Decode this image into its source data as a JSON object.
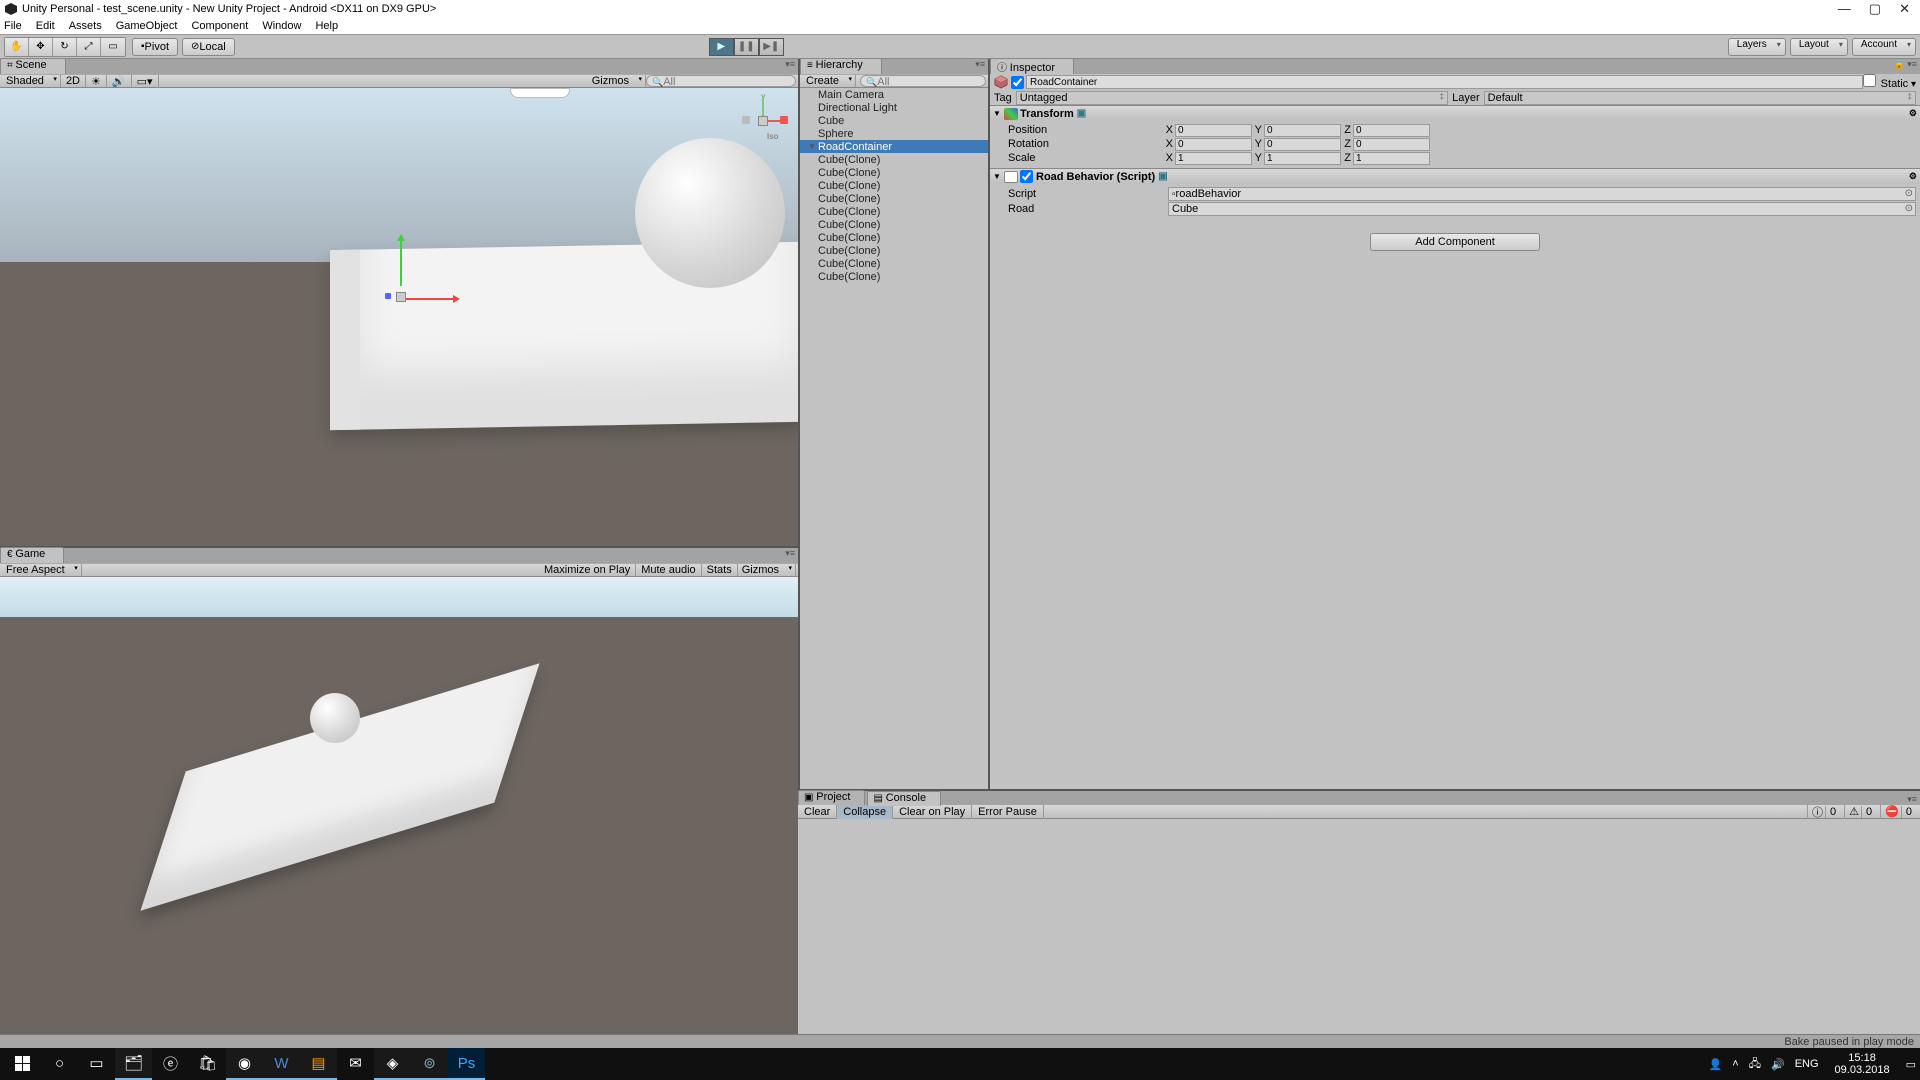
{
  "title": "Unity Personal - test_scene.unity - New Unity Project - Android <DX11 on DX9 GPU>",
  "menu": [
    "File",
    "Edit",
    "Assets",
    "GameObject",
    "Component",
    "Window",
    "Help"
  ],
  "toolbar": {
    "pivot": "Pivot",
    "local": "Local",
    "layers": "Layers",
    "layout": "Layout",
    "account": "Account"
  },
  "scene": {
    "tab": "Scene",
    "shading": "Shaded",
    "twoD": "2D",
    "gizmos": "Gizmos",
    "search_placeholder": "All",
    "orient_label": "Iso"
  },
  "game": {
    "tab": "Game",
    "aspect": "Free Aspect",
    "maxOnPlay": "Maximize on Play",
    "muteAudio": "Mute audio",
    "stats": "Stats",
    "gizmos": "Gizmos"
  },
  "hierarchy": {
    "tab": "Hierarchy",
    "create": "Create",
    "search_placeholder": "All",
    "items": [
      {
        "name": "Main Camera"
      },
      {
        "name": "Directional Light"
      },
      {
        "name": "Cube"
      },
      {
        "name": "Sphere"
      },
      {
        "name": "RoadContainer",
        "selected": true,
        "expandable": true
      },
      {
        "name": "Cube(Clone)",
        "indent": 1
      },
      {
        "name": "Cube(Clone)",
        "indent": 1
      },
      {
        "name": "Cube(Clone)",
        "indent": 1
      },
      {
        "name": "Cube(Clone)",
        "indent": 1
      },
      {
        "name": "Cube(Clone)",
        "indent": 1
      },
      {
        "name": "Cube(Clone)",
        "indent": 1
      },
      {
        "name": "Cube(Clone)",
        "indent": 1
      },
      {
        "name": "Cube(Clone)",
        "indent": 1
      },
      {
        "name": "Cube(Clone)",
        "indent": 1
      },
      {
        "name": "Cube(Clone)",
        "indent": 1
      }
    ]
  },
  "inspector": {
    "tab": "Inspector",
    "objectName": "RoadContainer",
    "staticLabel": "Static",
    "tagLabel": "Tag",
    "tagValue": "Untagged",
    "layerLabel": "Layer",
    "layerValue": "Default",
    "transform": {
      "title": "Transform",
      "position": {
        "label": "Position",
        "x": "0",
        "y": "0",
        "z": "0"
      },
      "rotation": {
        "label": "Rotation",
        "x": "0",
        "y": "0",
        "z": "0"
      },
      "scale": {
        "label": "Scale",
        "x": "1",
        "y": "1",
        "z": "1"
      }
    },
    "script": {
      "title": "Road Behavior (Script)",
      "scriptLabel": "Script",
      "scriptValue": "roadBehavior",
      "roadLabel": "Road",
      "roadValue": "Cube"
    },
    "addComponent": "Add Component"
  },
  "project": {
    "tab": "Project"
  },
  "console": {
    "tab": "Console",
    "clear": "Clear",
    "collapse": "Collapse",
    "clearOnPlay": "Clear on Play",
    "errorPause": "Error Pause",
    "counts": {
      "info": "0",
      "warn": "0",
      "error": "0"
    }
  },
  "status": "Bake paused in play mode",
  "system": {
    "lang": "ENG",
    "time": "15:18",
    "date": "09.03.2018"
  }
}
